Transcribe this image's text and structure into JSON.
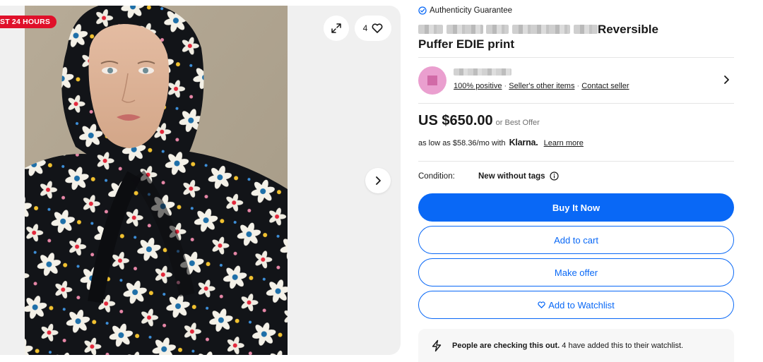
{
  "gallery": {
    "ribbon": "ST 24 HOURS",
    "watch_count": "4",
    "icons": {
      "expand": "expand-icon",
      "heart": "heart-icon",
      "next": "chevron-right-icon"
    }
  },
  "listing": {
    "authenticity": "Authenticity Guarantee",
    "title_visible_part1": "Reversible",
    "title_visible_part2": "Puffer EDIE print"
  },
  "seller": {
    "feedback": "100% positive",
    "sep1": " · ",
    "other_items": "Seller's other items",
    "sep2": " · ",
    "contact": "Contact seller"
  },
  "price": {
    "value": "US $650.00",
    "best_offer": "or Best Offer"
  },
  "financing": {
    "prefix": "as low as $58.36/mo with",
    "brand": "Klarna.",
    "learn_more": "Learn more"
  },
  "condition": {
    "label": "Condition:",
    "value": "New without tags"
  },
  "actions": {
    "buy_now": "Buy It Now",
    "add_to_cart": "Add to cart",
    "make_offer": "Make offer",
    "add_to_watchlist": "Add to Watchlist"
  },
  "notice": {
    "bold": "People are checking this out.",
    "rest": " 4 have added this to their watchlist."
  },
  "colors": {
    "primary": "#0968f6",
    "ribbon": "#e0102a",
    "avatar": "#ea9fcf"
  }
}
